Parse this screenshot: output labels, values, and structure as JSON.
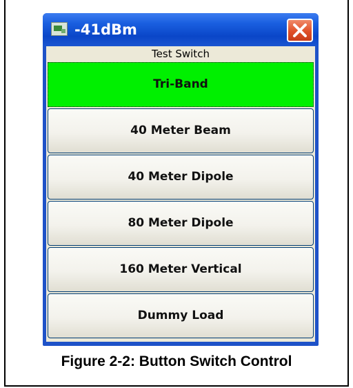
{
  "window": {
    "title": "-41dBm",
    "icon": "app-icon",
    "close_icon": "close-icon"
  },
  "switch": {
    "label": "Test Switch",
    "buttons": [
      {
        "label": "Tri-Band",
        "selected": true
      },
      {
        "label": "40 Meter Beam",
        "selected": false
      },
      {
        "label": "40 Meter Dipole",
        "selected": false
      },
      {
        "label": "80 Meter Dipole",
        "selected": false
      },
      {
        "label": "160 Meter Vertical",
        "selected": false
      },
      {
        "label": "Dummy Load",
        "selected": false
      }
    ]
  },
  "caption": "Figure 2-2:  Button Switch Control",
  "colors": {
    "selected": "#00f000",
    "titlebar": "#0a46c8",
    "panel": "#ece9d8",
    "close": "#e05028"
  }
}
